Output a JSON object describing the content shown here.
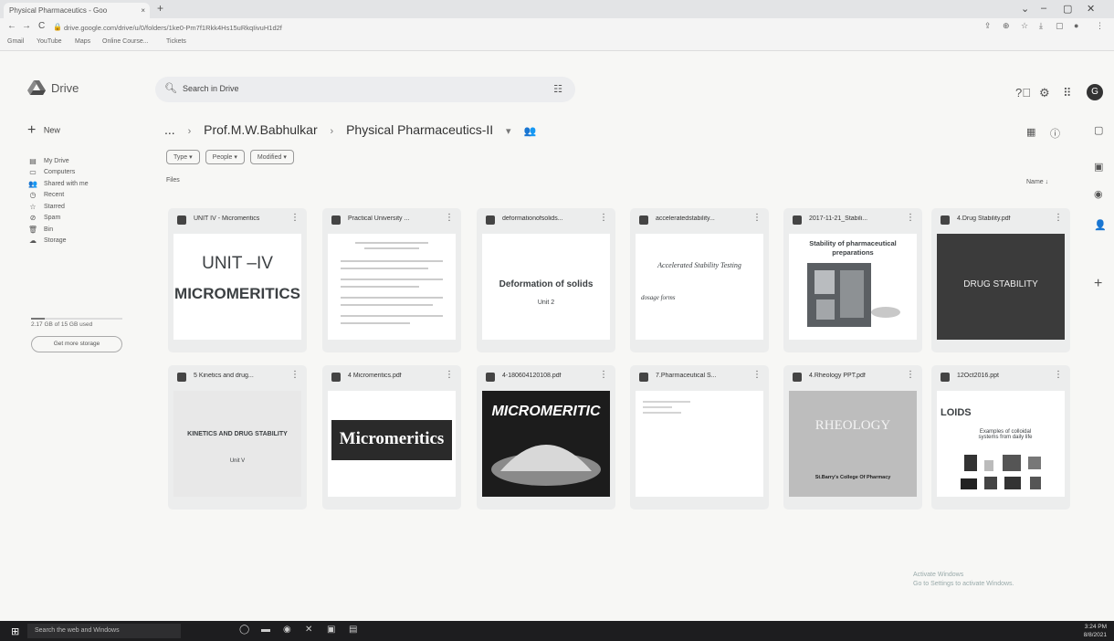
{
  "browser": {
    "tab_title": "Physical Pharmaceutics - Goo",
    "tab_close": "×",
    "new_tab": "+",
    "url": "drive.google.com/drive/u/0/folders/1ke0-Pm7f1Rkk4Hs15uRkqIivuH1d2f",
    "bookmarks": [
      "Gmail",
      "YouTube",
      "Maps",
      "Online Course...",
      "Tickets"
    ],
    "window_controls": [
      "⌄",
      "–",
      "▢",
      "✕"
    ]
  },
  "header": {
    "app_name": "Drive",
    "search_placeholder": "Search in Drive",
    "avatar_letter": "G"
  },
  "sidebar": {
    "new_label": "New",
    "items": [
      {
        "label": "My Drive",
        "icon": "▤"
      },
      {
        "label": "Computers",
        "icon": "▭"
      },
      {
        "label": "Shared with me",
        "icon": "👥"
      },
      {
        "label": "Recent",
        "icon": "◷"
      },
      {
        "label": "Starred",
        "icon": "☆"
      },
      {
        "label": "Spam",
        "icon": "⊘"
      },
      {
        "label": "Bin",
        "icon": "🗑"
      },
      {
        "label": "Storage",
        "icon": "☁"
      }
    ],
    "storage_text": "2.17 GB of 15 GB used",
    "storage_fraction": 0.145,
    "storage_button": "Get more storage"
  },
  "breadcrumb": {
    "ellipsis": "...",
    "parent": "Prof.M.W.Babhulkar",
    "current": "Physical Pharmaceutics-II"
  },
  "filters": [
    "Type",
    "People",
    "Modified"
  ],
  "files_label": "Files",
  "sort_label": "Name",
  "files": [
    {
      "name": "UNIT IV - Micromeritics",
      "thumb_lines": [
        "UNIT –IV",
        "MICROMERITICS"
      ]
    },
    {
      "name": "Practical University ...",
      "thumb_lines": []
    },
    {
      "name": "deformationofsolids...",
      "thumb_lines": [
        "Deformation of solids",
        "Unit 2"
      ]
    },
    {
      "name": "acceleratedstability...",
      "thumb_lines": [
        "Accelerated Stability Testing",
        "dosage forms"
      ]
    },
    {
      "name": "2017-11-21_Stabili...",
      "thumb_lines": [
        "Stability of pharmaceutical",
        "preparations"
      ]
    },
    {
      "name": "4.Drug Stability.pdf",
      "thumb_lines": [
        "DRUG STABILITY"
      ]
    },
    {
      "name": "5 Kinetics and drug...",
      "thumb_lines": [
        "KINETICS AND DRUG STABILITY",
        "Unit V"
      ]
    },
    {
      "name": "4 Micromeritics.pdf",
      "thumb_lines": [
        "Micromeritics"
      ]
    },
    {
      "name": "4-180604120108.pdf",
      "thumb_lines": [
        "MICROMERITIC"
      ]
    },
    {
      "name": "7.Pharmaceutical S...",
      "thumb_lines": []
    },
    {
      "name": "4.Rheology PPT.pdf",
      "thumb_lines": [
        "RHEOLOGY",
        "St.Barry's College Of Pharmacy"
      ]
    },
    {
      "name": "12Oct2016.ppt",
      "thumb_lines": [
        "LOIDS",
        "Examples of colloidal systems from daily life"
      ]
    }
  ],
  "taskbar": {
    "search_text": "Search the web and Windows",
    "time": "3:24 PM",
    "date": "8/8/2021"
  },
  "watermark": [
    "Activate Windows",
    "Go to Settings to activate Windows."
  ]
}
